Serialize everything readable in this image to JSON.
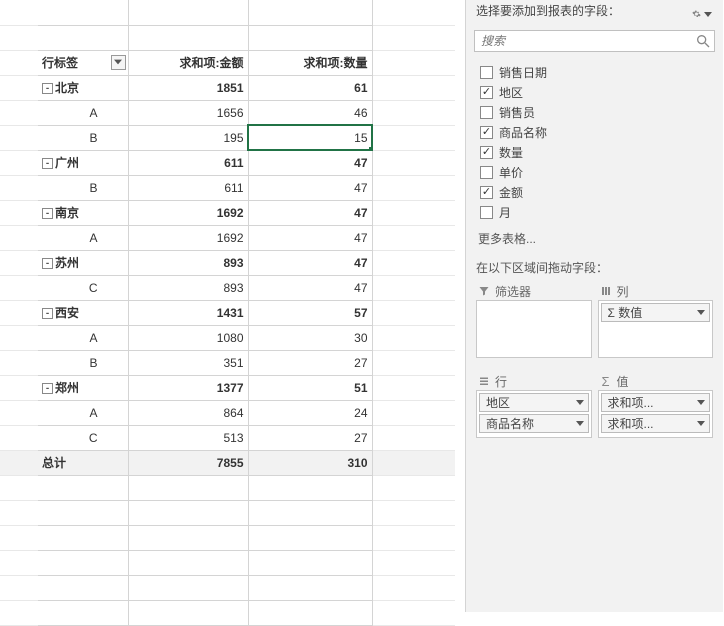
{
  "pivot": {
    "headers": {
      "row": "行标签",
      "amount": "求和项:金额",
      "qty": "求和项:数量"
    },
    "groups": [
      {
        "city": "北京",
        "amount": 1851,
        "qty": 61,
        "rows": [
          {
            "label": "A",
            "amount": 1656,
            "qty": 46
          },
          {
            "label": "B",
            "amount": 195,
            "qty": 15
          }
        ]
      },
      {
        "city": "广州",
        "amount": 611,
        "qty": 47,
        "rows": [
          {
            "label": "B",
            "amount": 611,
            "qty": 47
          }
        ]
      },
      {
        "city": "南京",
        "amount": 1692,
        "qty": 47,
        "rows": [
          {
            "label": "A",
            "amount": 1692,
            "qty": 47
          }
        ]
      },
      {
        "city": "苏州",
        "amount": 893,
        "qty": 47,
        "rows": [
          {
            "label": "C",
            "amount": 893,
            "qty": 47
          }
        ]
      },
      {
        "city": "西安",
        "amount": 1431,
        "qty": 57,
        "rows": [
          {
            "label": "A",
            "amount": 1080,
            "qty": 30
          },
          {
            "label": "B",
            "amount": 351,
            "qty": 27
          }
        ]
      },
      {
        "city": "郑州",
        "amount": 1377,
        "qty": 51,
        "rows": [
          {
            "label": "A",
            "amount": 864,
            "qty": 24
          },
          {
            "label": "C",
            "amount": 513,
            "qty": 27
          }
        ]
      }
    ],
    "total": {
      "label": "总计",
      "amount": 7855,
      "qty": 310
    },
    "selected": {
      "group": 0,
      "sub": 1,
      "col": "qty"
    }
  },
  "panel": {
    "title": "选择要添加到报表的字段：",
    "search_placeholder": "搜索",
    "fields": [
      {
        "label": "销售日期",
        "checked": false
      },
      {
        "label": "地区",
        "checked": true
      },
      {
        "label": "销售员",
        "checked": false
      },
      {
        "label": "商品名称",
        "checked": true
      },
      {
        "label": "数量",
        "checked": true
      },
      {
        "label": "单价",
        "checked": false
      },
      {
        "label": "金额",
        "checked": true
      },
      {
        "label": "月",
        "checked": false
      }
    ],
    "more_tables": "更多表格...",
    "drag_label": "在以下区域间拖动字段：",
    "zones": {
      "filter": {
        "title": "筛选器"
      },
      "columns": {
        "title": "列",
        "chips": [
          "Σ 数值"
        ]
      },
      "rows": {
        "title": "行",
        "chips": [
          "地区",
          "商品名称"
        ]
      },
      "values": {
        "title": "值",
        "chips": [
          "求和项...",
          "求和项..."
        ]
      }
    }
  }
}
